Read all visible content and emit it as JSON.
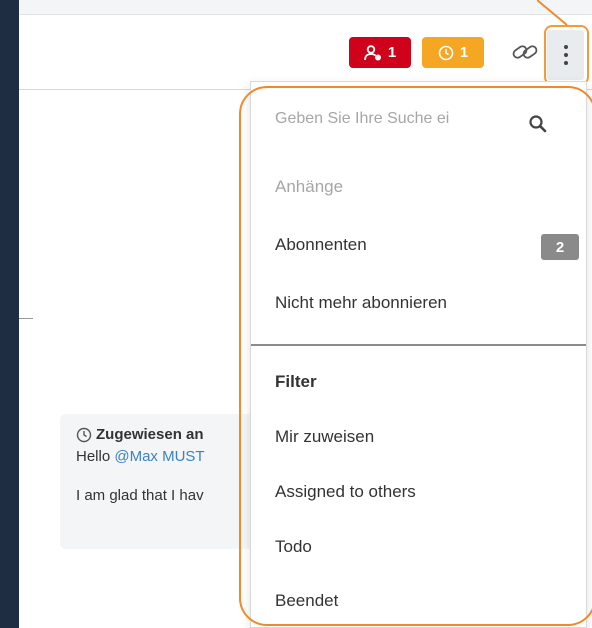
{
  "header": {
    "assignee_count": "1",
    "pending_count": "1"
  },
  "comment": {
    "title": "Zugewiesen an",
    "greeting": "Hello",
    "mention": "@Max MUST",
    "body": "I am glad that I hav"
  },
  "menu": {
    "search_placeholder": "Geben Sie Ihre Suche ei",
    "items": [
      {
        "label": "Anhänge"
      },
      {
        "label": "Abonnenten",
        "count": "2"
      },
      {
        "label": "Nicht mehr abonnieren"
      },
      {
        "label": "Filter"
      },
      {
        "label": "Mir zuweisen"
      },
      {
        "label": "Assigned to others"
      },
      {
        "label": "Todo"
      },
      {
        "label": "Beendet"
      }
    ]
  },
  "colors": {
    "badge_red": "#d0021b",
    "badge_orange": "#f5a623",
    "highlight": "#ef8a2c",
    "background": "#1f2d43"
  }
}
